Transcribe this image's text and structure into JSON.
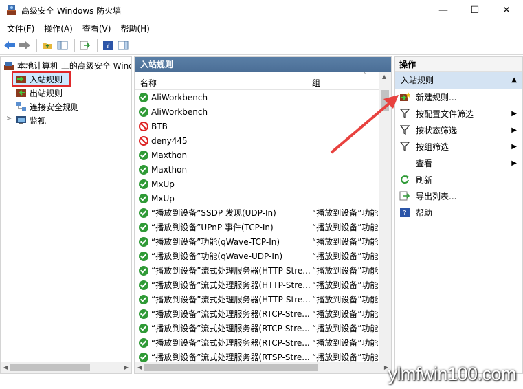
{
  "window": {
    "title": "高级安全 Windows 防火墙",
    "minimize": "—",
    "maximize": "☐",
    "close": "✕"
  },
  "menu": [
    "文件(F)",
    "操作(A)",
    "查看(V)",
    "帮助(H)"
  ],
  "tree": {
    "root": "本地计算机 上的高级安全 Windows",
    "items": [
      "入站规则",
      "出站规则",
      "连接安全规则",
      "监视"
    ]
  },
  "middle": {
    "header": "入站规则",
    "col_name": "名称",
    "col_group": "组",
    "rows": [
      {
        "name": "AliWorkbench",
        "group": "",
        "status": "allow"
      },
      {
        "name": "AliWorkbench",
        "group": "",
        "status": "allow"
      },
      {
        "name": "BTB",
        "group": "",
        "status": "block"
      },
      {
        "name": "deny445",
        "group": "",
        "status": "block"
      },
      {
        "name": "Maxthon",
        "group": "",
        "status": "allow"
      },
      {
        "name": "Maxthon",
        "group": "",
        "status": "allow"
      },
      {
        "name": "MxUp",
        "group": "",
        "status": "allow"
      },
      {
        "name": "MxUp",
        "group": "",
        "status": "allow"
      },
      {
        "name": "“播放到设备”SSDP 发现(UDP-In)",
        "group": "“播放到设备”功能",
        "status": "allow"
      },
      {
        "name": "“播放到设备”UPnP 事件(TCP-In)",
        "group": "“播放到设备”功能",
        "status": "allow"
      },
      {
        "name": "“播放到设备”功能(qWave-TCP-In)",
        "group": "“播放到设备”功能",
        "status": "allow"
      },
      {
        "name": "“播放到设备”功能(qWave-UDP-In)",
        "group": "“播放到设备”功能",
        "status": "allow"
      },
      {
        "name": "“播放到设备”流式处理服务器(HTTP-Stre...",
        "group": "“播放到设备”功能",
        "status": "allow"
      },
      {
        "name": "“播放到设备”流式处理服务器(HTTP-Stre...",
        "group": "“播放到设备”功能",
        "status": "allow"
      },
      {
        "name": "“播放到设备”流式处理服务器(HTTP-Stre...",
        "group": "“播放到设备”功能",
        "status": "allow"
      },
      {
        "name": "“播放到设备”流式处理服务器(RTCP-Stre...",
        "group": "“播放到设备”功能",
        "status": "allow"
      },
      {
        "name": "“播放到设备”流式处理服务器(RTCP-Stre...",
        "group": "“播放到设备”功能",
        "status": "allow"
      },
      {
        "name": "“播放到设备”流式处理服务器(RTCP-Stre...",
        "group": "“播放到设备”功能",
        "status": "allow"
      },
      {
        "name": "“播放到设备”流式处理服务器(RTSP-Stre...",
        "group": "“播放到设备”功能",
        "status": "allow"
      }
    ]
  },
  "actions": {
    "header": "操作",
    "section": "入站规则",
    "items": [
      {
        "label": "新建规则...",
        "icon": "new-rule-icon",
        "submenu": false
      },
      {
        "label": "按配置文件筛选",
        "icon": "filter-icon",
        "submenu": true
      },
      {
        "label": "按状态筛选",
        "icon": "filter-icon",
        "submenu": true
      },
      {
        "label": "按组筛选",
        "icon": "filter-icon",
        "submenu": true
      },
      {
        "label": "查看",
        "icon": "",
        "submenu": true
      },
      {
        "label": "刷新",
        "icon": "refresh-icon",
        "submenu": false
      },
      {
        "label": "导出列表...",
        "icon": "export-icon",
        "submenu": false
      },
      {
        "label": "帮助",
        "icon": "help-icon",
        "submenu": false
      }
    ]
  },
  "watermark": "ylmfwin100.com",
  "colors": {
    "pane_header": "#4b6e96",
    "selection_outline": "#e0292b",
    "allow": "#2f9a36",
    "block": "#dd2222",
    "actions_section": "#d4e3f3"
  }
}
